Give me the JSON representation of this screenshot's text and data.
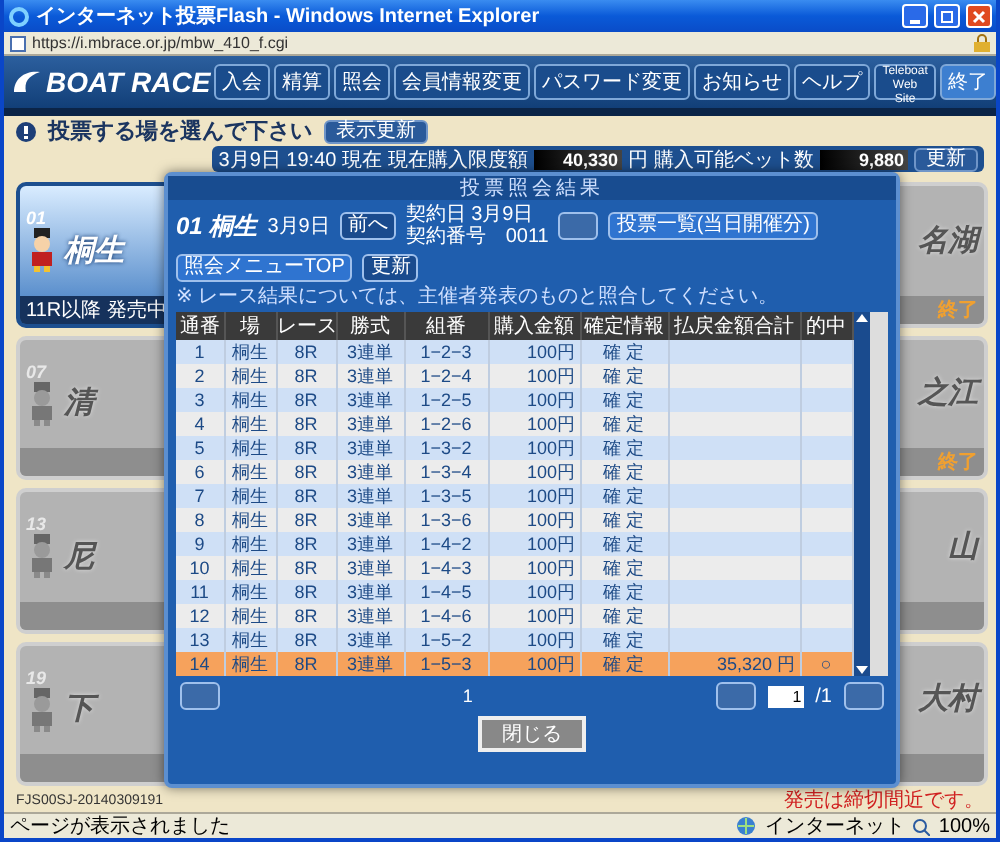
{
  "window": {
    "title": "インターネット投票Flash - Windows Internet Explorer",
    "address": "https://i.mbrace.or.jp/mbw_410_f.cgi"
  },
  "header": {
    "logo": "BOAT RACE",
    "buttons": [
      {
        "label": "入会",
        "kind": "normal"
      },
      {
        "label": "精算",
        "kind": "normal"
      },
      {
        "label": "照会",
        "kind": "normal"
      },
      {
        "label": "会員情報変更",
        "kind": "normal"
      },
      {
        "label": "パスワード変更",
        "kind": "normal"
      },
      {
        "label": "お知らせ",
        "kind": "normal"
      },
      {
        "label": "ヘルプ",
        "kind": "normal"
      },
      {
        "label": "Teleboat Web Site",
        "kind": "small"
      },
      {
        "label": "終了",
        "kind": "exit"
      }
    ]
  },
  "selector": {
    "prompt": "投票する場を選んで下さい",
    "refresh": "表示更新",
    "as_of": "3月9日 19:40 現在",
    "limit_label": "現在購入限度額",
    "limit_value": "40,330",
    "limit_unit": "円",
    "bets_label": "購入可能ベット数",
    "bets_value": "9,880",
    "update": "更新"
  },
  "venues_left": [
    {
      "code": "01",
      "name": "桐生",
      "note": "11R以降 発売中",
      "active": true
    },
    {
      "code": "07",
      "name": "清",
      "active": false
    },
    {
      "code": "13",
      "name": "尼",
      "active": false
    },
    {
      "code": "19",
      "name": "下",
      "active": false
    }
  ],
  "venues_right": [
    {
      "name": "名湖",
      "note": "終了"
    },
    {
      "name": "之江",
      "note": "終了"
    },
    {
      "name": "山"
    },
    {
      "name": "大村"
    }
  ],
  "footer": {
    "code": "FJS00SJ-20140309191",
    "notice": "発売は締切間近です。"
  },
  "modal": {
    "title": "投票照会結果",
    "venue_code": "01",
    "venue_name": "桐生",
    "date": "3月9日",
    "prev": "前へ",
    "contract_date": "契約日 3月9日",
    "contract_no": "契約番号　0011",
    "list_button": "投票一覧(当日開催分)",
    "menu_button": "照会メニューTOP",
    "update": "更新",
    "note": "※ レース結果については、主催者発表のものと照合してください。",
    "columns": [
      "通番",
      "場",
      "レース",
      "勝式",
      "組番",
      "購入金額",
      "確定情報",
      "払戻金額合計",
      "的中"
    ],
    "rows": [
      {
        "no": "1",
        "venue": "桐生",
        "race": "8R",
        "type": "3連単",
        "combo": "1−2−3",
        "amount": "100円",
        "status": "確 定",
        "selected": false
      },
      {
        "no": "2",
        "venue": "桐生",
        "race": "8R",
        "type": "3連単",
        "combo": "1−2−4",
        "amount": "100円",
        "status": "確 定",
        "selected": false
      },
      {
        "no": "3",
        "venue": "桐生",
        "race": "8R",
        "type": "3連単",
        "combo": "1−2−5",
        "amount": "100円",
        "status": "確 定",
        "selected": false
      },
      {
        "no": "4",
        "venue": "桐生",
        "race": "8R",
        "type": "3連単",
        "combo": "1−2−6",
        "amount": "100円",
        "status": "確 定",
        "selected": false
      },
      {
        "no": "5",
        "venue": "桐生",
        "race": "8R",
        "type": "3連単",
        "combo": "1−3−2",
        "amount": "100円",
        "status": "確 定",
        "selected": false
      },
      {
        "no": "6",
        "venue": "桐生",
        "race": "8R",
        "type": "3連単",
        "combo": "1−3−4",
        "amount": "100円",
        "status": "確 定",
        "selected": false
      },
      {
        "no": "7",
        "venue": "桐生",
        "race": "8R",
        "type": "3連単",
        "combo": "1−3−5",
        "amount": "100円",
        "status": "確 定",
        "selected": false
      },
      {
        "no": "8",
        "venue": "桐生",
        "race": "8R",
        "type": "3連単",
        "combo": "1−3−6",
        "amount": "100円",
        "status": "確 定",
        "selected": false
      },
      {
        "no": "9",
        "venue": "桐生",
        "race": "8R",
        "type": "3連単",
        "combo": "1−4−2",
        "amount": "100円",
        "status": "確 定",
        "selected": false
      },
      {
        "no": "10",
        "venue": "桐生",
        "race": "8R",
        "type": "3連単",
        "combo": "1−4−3",
        "amount": "100円",
        "status": "確 定",
        "selected": false
      },
      {
        "no": "11",
        "venue": "桐生",
        "race": "8R",
        "type": "3連単",
        "combo": "1−4−5",
        "amount": "100円",
        "status": "確 定",
        "selected": false
      },
      {
        "no": "12",
        "venue": "桐生",
        "race": "8R",
        "type": "3連単",
        "combo": "1−4−6",
        "amount": "100円",
        "status": "確 定",
        "selected": false
      },
      {
        "no": "13",
        "venue": "桐生",
        "race": "8R",
        "type": "3連単",
        "combo": "1−5−2",
        "amount": "100円",
        "status": "確 定",
        "selected": false
      },
      {
        "no": "14",
        "venue": "桐生",
        "race": "8R",
        "type": "3連単",
        "combo": "1−5−3",
        "amount": "100円",
        "status": "確 定",
        "payout": "35,320 円",
        "hit": "○",
        "selected": true
      }
    ],
    "page": "1",
    "page_input": "1",
    "page_total": "/1",
    "close": "閉じる"
  },
  "status_bar": {
    "message": "ページが表示されました",
    "zone": "インターネット",
    "zoom": "100%"
  }
}
